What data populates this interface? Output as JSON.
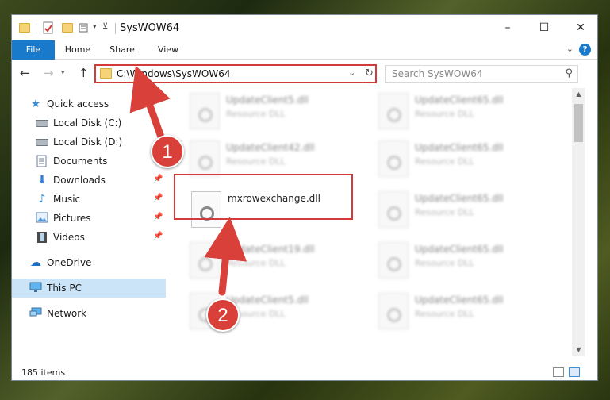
{
  "window": {
    "title": "SysWOW64",
    "controls": {
      "minimize": "–",
      "maximize": "☐",
      "close": "✕"
    }
  },
  "ribbon": {
    "tabs": [
      "File",
      "Home",
      "Share",
      "View"
    ],
    "help": "?"
  },
  "address": {
    "path": "C:\\Windows\\SysWOW64",
    "search_placeholder": "Search SysWOW64"
  },
  "sidebar": {
    "items": [
      {
        "label": "Quick access",
        "icon": "star-icon"
      },
      {
        "label": "Local Disk (C:)",
        "icon": "disk-icon"
      },
      {
        "label": "Local Disk (D:)",
        "icon": "disk-icon"
      },
      {
        "label": "Documents",
        "icon": "documents-icon"
      },
      {
        "label": "Downloads",
        "icon": "downloads-icon"
      },
      {
        "label": "Music",
        "icon": "music-icon"
      },
      {
        "label": "Pictures",
        "icon": "pictures-icon"
      },
      {
        "label": "Videos",
        "icon": "videos-icon"
      },
      {
        "label": "OneDrive",
        "icon": "cloud-icon"
      },
      {
        "label": "This PC",
        "icon": "computer-icon"
      },
      {
        "label": "Network",
        "icon": "network-icon"
      }
    ]
  },
  "files": [
    {
      "name": "UpdateClient5.dll",
      "type": "Resource DLL"
    },
    {
      "name": "UpdateClient65.dll",
      "type": "Resource DLL"
    },
    {
      "name": "UpdateClient42.dll",
      "type": "Resource DLL"
    },
    {
      "name": "UpdateClient65.dll",
      "type": "Resource DLL"
    },
    {
      "name": "mxrowexchange.dll",
      "type": ""
    },
    {
      "name": "UpdateClient65.dll",
      "type": "Resource DLL"
    },
    {
      "name": "UpdateClient19.dll",
      "type": "Resource DLL"
    },
    {
      "name": "UpdateClient65.dll",
      "type": "Resource DLL"
    },
    {
      "name": "UpdateClient5.dll",
      "type": "Resource DLL"
    },
    {
      "name": "UpdateClient65.dll",
      "type": "Resource DLL"
    }
  ],
  "status": {
    "item_count": "185 items"
  },
  "annotations": {
    "step1": "1",
    "step2": "2",
    "color": "#d9403a"
  }
}
